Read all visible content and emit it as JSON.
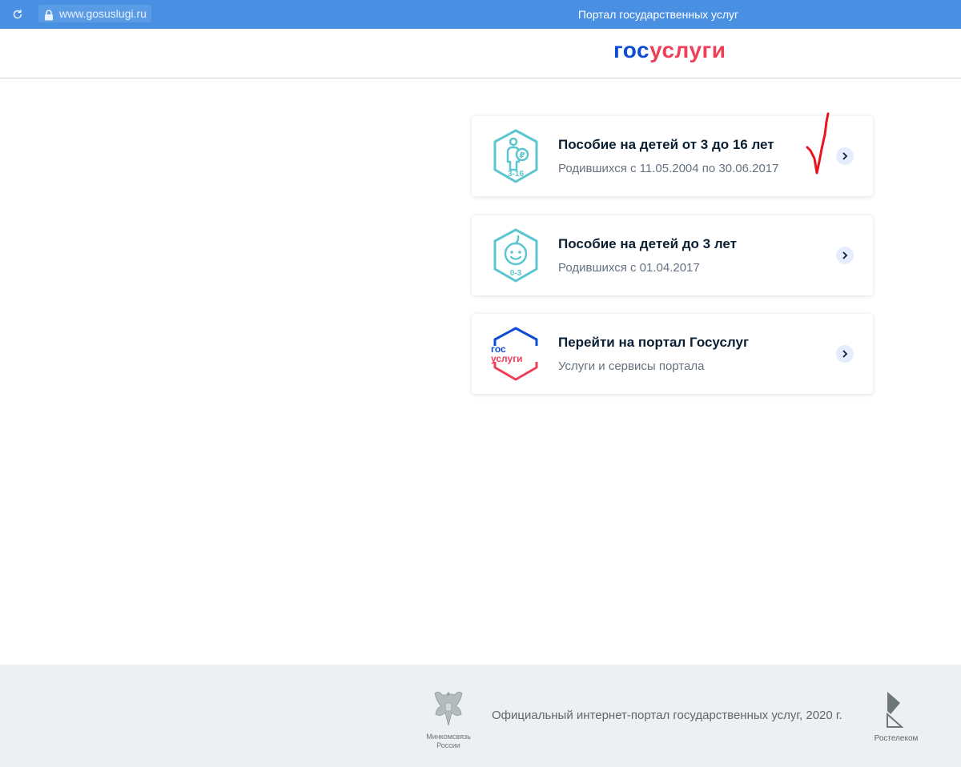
{
  "browser": {
    "url": "www.gosuslugi.ru",
    "title": "Портал государственных услуг"
  },
  "header": {
    "logo_part1": "гос",
    "logo_part2": "услуги"
  },
  "cards": [
    {
      "title": "Пособие на детей от 3 до 16 лет",
      "subtitle": "Родившихся с 11.05.2004 по 30.06.2017",
      "icon_label": "3-16",
      "icon": "child-ruble-icon"
    },
    {
      "title": "Пособие на детей до 3 лет",
      "subtitle": "Родившихся с 01.04.2017",
      "icon_label": "0-3",
      "icon": "baby-face-icon"
    },
    {
      "title": "Перейти на портал Госуслуг",
      "subtitle": "Услуги и сервисы портала",
      "icon_label_1": "гос",
      "icon_label_2": "услуги",
      "icon": "gosuslugi-logo-icon"
    }
  ],
  "footer": {
    "ministry_line1": "Минкомсвязь",
    "ministry_line2": "России",
    "copyright": "Официальный интернет-портал государственных услуг, 2020 г.",
    "partner": "Ростелеком"
  },
  "colors": {
    "topbar": "#4a90e2",
    "logo_blue": "#0d4cd3",
    "logo_red": "#ee3f58",
    "icon_teal": "#5cc6d0",
    "annotation_red": "#e8141d"
  }
}
